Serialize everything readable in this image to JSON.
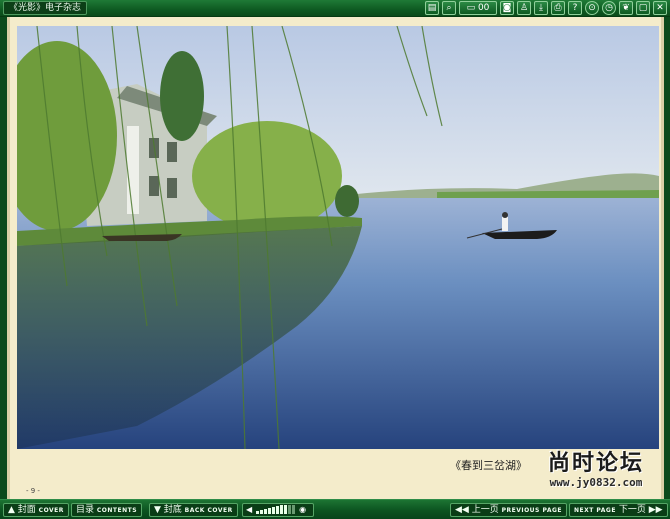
{
  "app": {
    "title": "《光影》电子杂志"
  },
  "toolbar": {
    "buttons": [
      {
        "name": "page-list-icon",
        "glyph": "▤"
      },
      {
        "name": "zoom-icon",
        "glyph": "⌕"
      },
      {
        "name": "page-jump-icon",
        "glyph": "▭ 00"
      },
      {
        "name": "comment-icon",
        "glyph": "◙"
      },
      {
        "name": "user-icon",
        "glyph": "♙"
      },
      {
        "name": "download-icon",
        "glyph": "⤓"
      },
      {
        "name": "print-icon",
        "glyph": "⎙"
      },
      {
        "name": "help-icon",
        "glyph": "?"
      },
      {
        "name": "settings-icon",
        "glyph": "⊙"
      },
      {
        "name": "clock-icon",
        "glyph": "◷"
      },
      {
        "name": "leaf-icon",
        "glyph": "❦"
      },
      {
        "name": "window-icon",
        "glyph": "▢"
      },
      {
        "name": "close-icon",
        "glyph": "✕"
      }
    ]
  },
  "page": {
    "caption": "《春到三岔湖》",
    "page_number": "- 9 -",
    "watermark_cn": "尚时论坛",
    "watermark_url": "www.jy0832.com"
  },
  "bottom_nav": {
    "cover": {
      "cn": "▲ 封面",
      "en": "COVER"
    },
    "contents": {
      "cn": "目录",
      "en": "CONTENTS"
    },
    "back_cover": {
      "cn": "▼ 封底",
      "en": "BACK COVER"
    },
    "prev": {
      "cn": "◀◀ 上一页",
      "en": "PREVIOUS PAGE"
    },
    "next": {
      "en": "NEXT PAGE",
      "cn": "下一页 ▶▶"
    }
  },
  "volume": {
    "level": 0.75
  },
  "colors": {
    "bar_green": "#0e5a22",
    "page_bg": "#f4eccb",
    "lake_blue": "#5d86b8"
  }
}
